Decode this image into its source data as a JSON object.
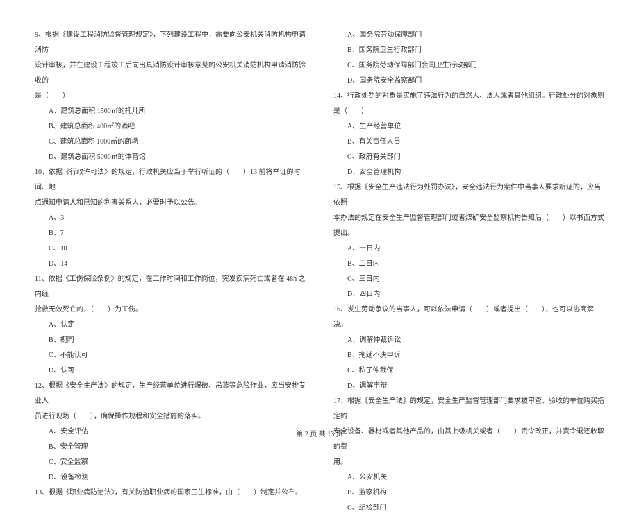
{
  "left": {
    "q9_l1": "9、根据《建设工程消防监督管理规定》，下列建设工程中，需要向公安机关消防机构申请消防",
    "q9_l2": "设计审核，并在建设工程竣工后向出具消防设计审核意见的公安机关消防机构申请消防验收的",
    "q9_l3": "是（　　）",
    "q9_a": "A、建筑总面积 1500㎡的托儿所",
    "q9_b": "B、建筑总面积 400㎡的酒吧",
    "q9_c": "C、建筑总面积 1000㎡的商场",
    "q9_d": "D、建筑总面积 5000㎡的体育馆",
    "q10_l1": "10、依据《行政许可法》的规定，行政机关应当于举行听证的（　　）13 前将举证的时间、地",
    "q10_l2": "点通知申请人和已知的利害关系人，必要时予以公告。",
    "q10_a": "A、3",
    "q10_b": "B、7",
    "q10_c": "C、10",
    "q10_d": "D、14",
    "q11_l1": "11、依据《工伤保险条例》的规定，在工作时间和工作岗位，突发疾病死亡或者在 48h 之内经",
    "q11_l2": "抢救无效死亡的，（　　）为工伤。",
    "q11_a": "A、认定",
    "q11_b": "B、视同",
    "q11_c": "C、不能认可",
    "q11_d": "D、认可",
    "q12_l1": "12、根据《安全生产法》的规定，生产经营单位进行爆破、吊装等危险作业，应当安排专业人",
    "q12_l2": "员进行现场（　　），确保操作规程和安全措施的落实。",
    "q12_a": "A、安全评估",
    "q12_b": "B、安全管理",
    "q12_c": "C、安全监察",
    "q12_d": "D、设备检测",
    "q13_l1": "13、根据《职业病防治法》，有关防治职业病的国家卫生标准，由（　　）制定并公布。"
  },
  "right": {
    "q13_a": "A、国务院劳动保障部门",
    "q13_b": "B、国务院卫生行政部门",
    "q13_c": "C、国务院劳动保障部门会同卫生行政部门",
    "q13_d": "D、国务院安全监察部门",
    "q14_l1": "14、行政处罚的对象是实施了违法行为的自然人、法人或者其他组织。行政处分的对象则是（　　）",
    "q14_a": "A、生产经营单位",
    "q14_b": "B、有关责任人员",
    "q14_c": "C、政府有关部门",
    "q14_d": "D、安全管理机构",
    "q15_l1": "15、根据《安全生产违法行为处罚办法》，安全违法行为案件中当事人要求听证的，应当依照",
    "q15_l2": "本办法的规定在安全生产监督管理部门或者煤矿安全监察机构告知后（　　）以书面方式提出。",
    "q15_a": "A、一日内",
    "q15_b": "B、二日内",
    "q15_c": "C、三日内",
    "q15_d": "D、四日内",
    "q16_l1": "16、发生劳动争议的当事人，可以依法申请（　　）或者提出（　　），也可以协商解决。",
    "q16_a": "A、调解仲裁诉讼",
    "q16_b": "B、拖延不决申诉",
    "q16_c": "C、私了仲裁保",
    "q16_d": "D、调解申辩",
    "q17_l1": "17、根据《安全生产法》的规定，安全生产监督管理部门要求被审查、验收的单位购买指定的",
    "q17_l2": "安全设备、器材或者其他产品的，由其上级机关或者（　　）责令改正，并责令退还收取的费",
    "q17_l3": "用。",
    "q17_a": "A、公安机关",
    "q17_b": "B、监察机构",
    "q17_c": "C、纪检部门"
  },
  "footer": "第 2 页 共 13 页"
}
